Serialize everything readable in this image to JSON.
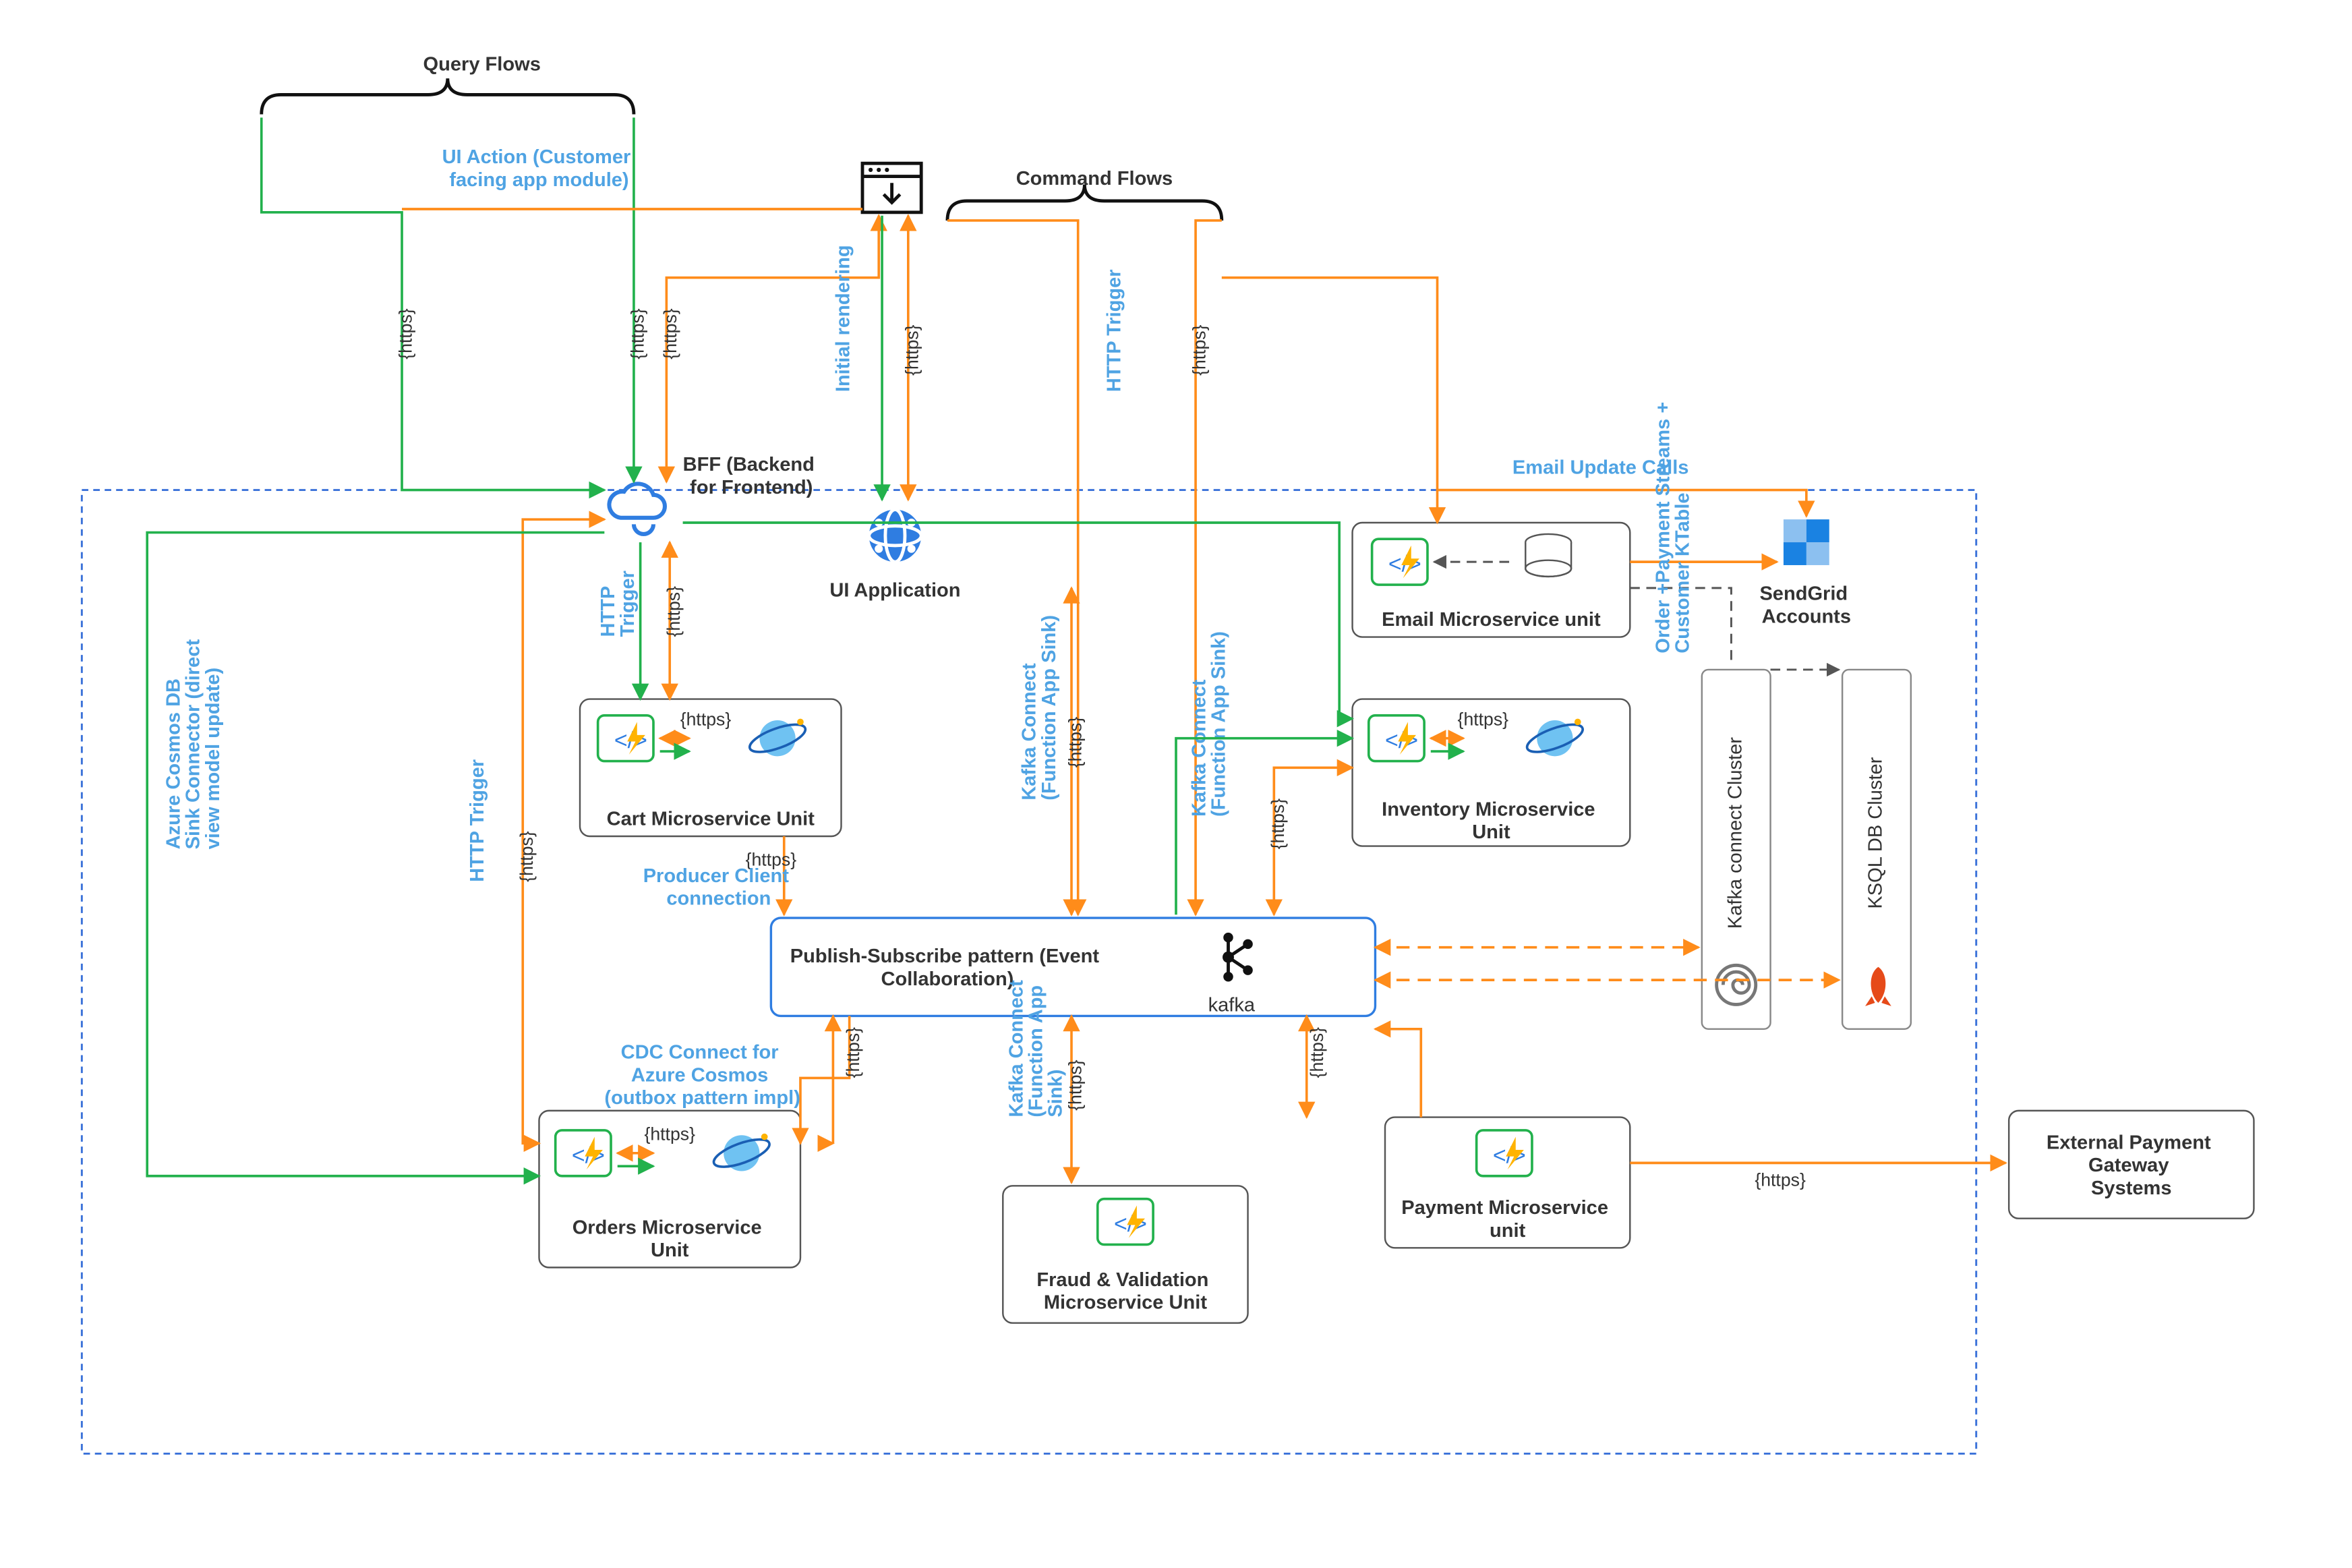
{
  "diagram": {
    "titles": {
      "query_flows": "Query Flows",
      "command_flows": "Command Flows"
    },
    "nodes": {
      "bff": {
        "label": "BFF (Backend\nfor Frontend)"
      },
      "ui_app": {
        "label": "UI Application"
      },
      "cart_ms": {
        "label": "Cart Microservice Unit",
        "internal_label": "{https}"
      },
      "orders_ms": {
        "label": "Orders Microservice\nUnit",
        "internal_label": "{https}"
      },
      "fraud_ms": {
        "label": "Fraud & Validation\nMicroservice Unit"
      },
      "payment_ms": {
        "label": "Payment Microservice\nunit"
      },
      "inventory_ms": {
        "label": "Inventory Microservice\nUnit",
        "internal_label": "{https}"
      },
      "email_ms": {
        "label": "Email Microservice unit"
      },
      "sendgrid": {
        "label": "SendGrid\nAccounts"
      },
      "kafka_connect_cluster": {
        "label": "Kafka connect Cluster"
      },
      "ksql_cluster": {
        "label": "KSQL DB Cluster"
      },
      "ext_payment": {
        "label": "External Payment\nGateway\nSystems"
      },
      "pubsub": {
        "label": "Publish-Subscribe pattern (Event\nCollaboration)",
        "tech": "kafka"
      }
    },
    "edges": {
      "ui_action": "UI Action (Customer\nfacing app module)",
      "initial_rendering": "Initial rendering",
      "http_trigger": "HTTP Trigger",
      "https": "{https}",
      "producer_client": "Producer Client\nconnection",
      "kafka_connect_sink": "Kafka Connect\n(Function App Sink)",
      "kafka_connect_sink_short": "Kafka Connect\n(Function App\nSink)",
      "email_update_calls": "Email Update Calls",
      "order_payment_ktable": "Order +Payment Streams +\nCustomer KTable",
      "cosmos_sink_direct": "Azure Cosmos DB\nSink Connector (direct\nview model update)",
      "cdc_outbox": "CDC Connect for\nAzure Cosmos\n(outbox pattern impl)"
    }
  }
}
